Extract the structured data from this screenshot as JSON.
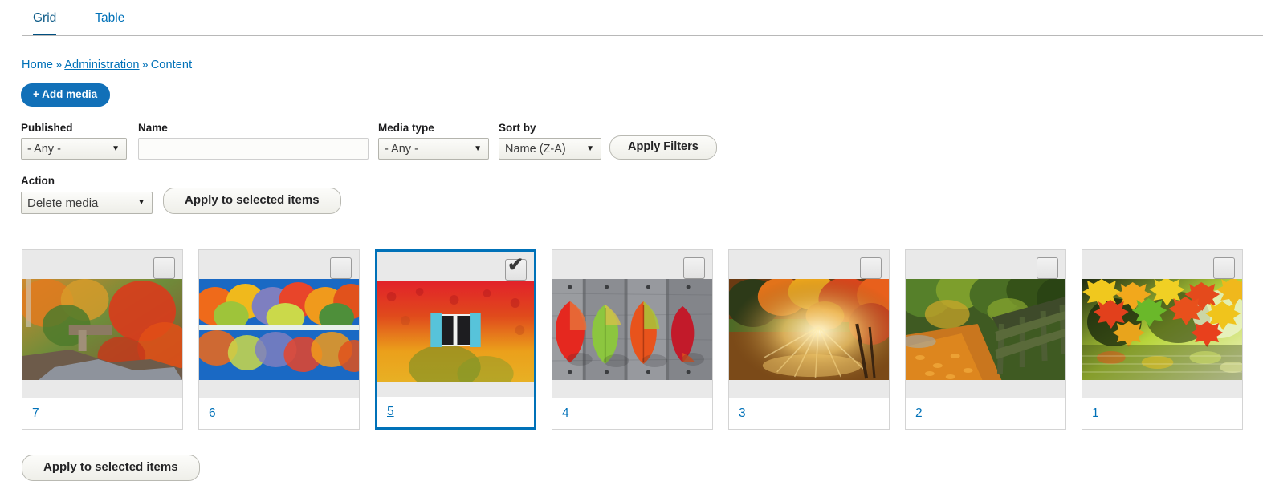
{
  "tabs": [
    {
      "label": "Grid",
      "active": true
    },
    {
      "label": "Table",
      "active": false
    }
  ],
  "breadcrumb": {
    "items": [
      "Home",
      "Administration",
      "Content"
    ],
    "separator": "»"
  },
  "toolbar": {
    "add_media_label": "+ Add media"
  },
  "filters": {
    "published": {
      "label": "Published",
      "value": "- Any -"
    },
    "name": {
      "label": "Name",
      "value": "",
      "placeholder": ""
    },
    "media_type": {
      "label": "Media type",
      "value": "- Any -"
    },
    "sort_by": {
      "label": "Sort by",
      "value": "Name (Z-A)"
    },
    "apply_label": "Apply Filters"
  },
  "action": {
    "label": "Action",
    "value": "Delete media",
    "apply_label": "Apply to selected items"
  },
  "bottom": {
    "apply_label": "Apply to selected items"
  },
  "icons": {
    "checkbox_check": "✔",
    "select_arrow": "▼"
  },
  "colors": {
    "accent": "#0071b8",
    "active_tab_underline": "#004f80",
    "add_media_bg": "#1170b8",
    "card_media_bg": "#e9e9e9",
    "selected_border": "#0071b8"
  },
  "media_items": [
    {
      "name": "7",
      "selected": false,
      "alt": "autumn stream with rocks and orange foliage"
    },
    {
      "name": "6",
      "selected": false,
      "alt": "vivid multicolored trees reflected in blue lake"
    },
    {
      "name": "5",
      "selected": true,
      "alt": "red and orange ivy wall with blue shuttered window"
    },
    {
      "name": "4",
      "selected": false,
      "alt": "four colorful leaves on weathered wood planks"
    },
    {
      "name": "3",
      "selected": false,
      "alt": "sun rays through orange autumn tree"
    },
    {
      "name": "2",
      "selected": false,
      "alt": "leaf covered path beside wooden fence"
    },
    {
      "name": "1",
      "selected": false,
      "alt": "yellow red and green maple leaves over water"
    }
  ]
}
